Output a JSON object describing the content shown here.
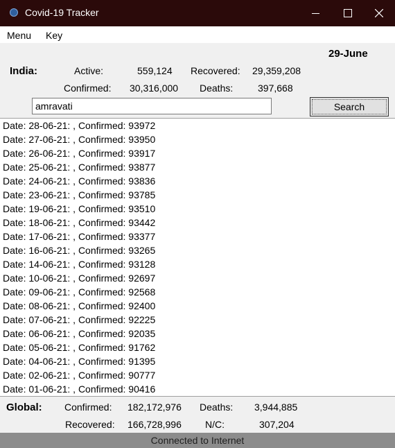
{
  "window": {
    "title": "Covid-19 Tracker"
  },
  "menu": {
    "items": [
      "Menu",
      "Key"
    ]
  },
  "date_label": "29-June",
  "india": {
    "label": "India:",
    "active_label": "Active:",
    "active": "559,124",
    "recovered_label": "Recovered:",
    "recovered": "29,359,208",
    "confirmed_label": "Confirmed:",
    "confirmed": "30,316,000",
    "deaths_label": "Deaths:",
    "deaths": "397,668"
  },
  "search": {
    "value": "amravati",
    "button_label": "Search"
  },
  "results": [
    "Date: 28-06-21: , Confirmed: 93972",
    "Date: 27-06-21: , Confirmed: 93950",
    "Date: 26-06-21: , Confirmed: 93917",
    "Date: 25-06-21: , Confirmed: 93877",
    "Date: 24-06-21: , Confirmed: 93836",
    "Date: 23-06-21: , Confirmed: 93785",
    "Date: 19-06-21: , Confirmed: 93510",
    "Date: 18-06-21: , Confirmed: 93442",
    "Date: 17-06-21: , Confirmed: 93377",
    "Date: 16-06-21: , Confirmed: 93265",
    "Date: 14-06-21: , Confirmed: 93128",
    "Date: 10-06-21: , Confirmed: 92697",
    "Date: 09-06-21: , Confirmed: 92568",
    "Date: 08-06-21: , Confirmed: 92400",
    "Date: 07-06-21: , Confirmed: 92225",
    "Date: 06-06-21: , Confirmed: 92035",
    "Date: 05-06-21: , Confirmed: 91762",
    "Date: 04-06-21: , Confirmed: 91395",
    "Date: 02-06-21: , Confirmed: 90777",
    "Date: 01-06-21: , Confirmed: 90416"
  ],
  "global": {
    "label": "Global:",
    "confirmed_label": "Confirmed:",
    "confirmed": "182,172,976",
    "deaths_label": "Deaths:",
    "deaths": "3,944,885",
    "recovered_label": "Recovered:",
    "recovered": "166,728,996",
    "nc_label": "N/C:",
    "nc": "307,204"
  },
  "status": "Connected to Internet"
}
